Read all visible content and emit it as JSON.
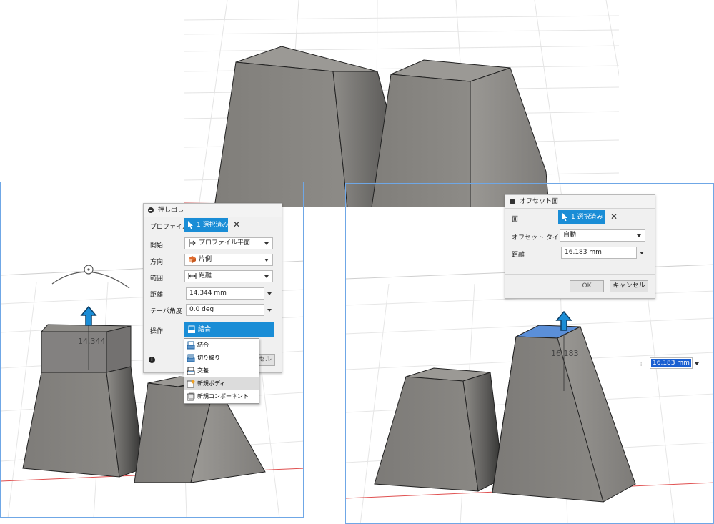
{
  "top_panel": {},
  "left_panel": {
    "dialog": {
      "title": "押し出し",
      "profile": {
        "label": "プロファイル",
        "value": "1 選択済み"
      },
      "start": {
        "label": "開始",
        "value": "プロファイル平面"
      },
      "direction": {
        "label": "方向",
        "value": "片側"
      },
      "extent": {
        "label": "範囲",
        "value": "距離"
      },
      "distance": {
        "label": "距離",
        "value": "14.344 mm"
      },
      "taper": {
        "label": "テーパ角度",
        "value": "0.0 deg"
      },
      "operation": {
        "label": "操作",
        "value": "結合"
      },
      "cancel_partial": "セル"
    },
    "operation_menu": [
      {
        "label": "結合",
        "icon": "join-icon"
      },
      {
        "label": "切り取り",
        "icon": "cut-icon"
      },
      {
        "label": "交差",
        "icon": "intersect-icon"
      },
      {
        "label": "新規ボディ",
        "icon": "new-body-icon"
      },
      {
        "label": "新規コンポーネント",
        "icon": "new-component-icon"
      }
    ],
    "highlighted_item": "新規ボディ",
    "dimension_label": "14.344"
  },
  "right_panel": {
    "dialog": {
      "title": "オフセット面",
      "face": {
        "label": "面",
        "value": "1 選択済み"
      },
      "offset_type": {
        "label": "オフセット タイプ",
        "value": "自動"
      },
      "distance": {
        "label": "距離",
        "value": "16.183 mm"
      },
      "ok": "OK",
      "cancel": "キャンセル"
    },
    "dimension_label": "16.183",
    "distance_input": "16.183 mm"
  },
  "colors": {
    "accent": "#1a8dd6",
    "face_selected": "#5b8fd8",
    "body": "#8a8884",
    "panel_border": "#6fa7e6"
  }
}
